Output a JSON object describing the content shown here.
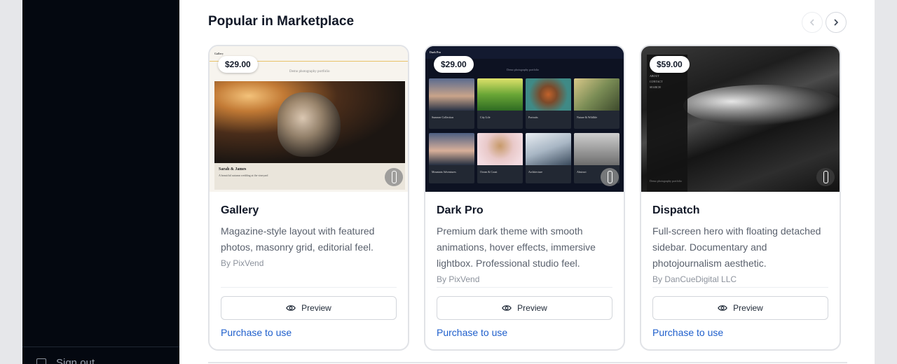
{
  "sidebar": {
    "signout_label": "Sign out"
  },
  "section": {
    "title": "Popular in Marketplace"
  },
  "cards": [
    {
      "price": "$29.00",
      "title": "Gallery",
      "description": "Magazine-style layout with featured photos, masonry grid, editorial feel.",
      "author": "By PixVend",
      "preview_label": "Preview",
      "purchase_label": "Purchase to use",
      "thumb": {
        "site_name": "Gallery",
        "tagline": "Demo photography portfolio",
        "couple": "Sarah & James",
        "couple_sub": "A beautiful autumn wedding at the vineyard"
      }
    },
    {
      "price": "$29.00",
      "title": "Dark Pro",
      "description": "Premium dark theme with smooth animations, hover effects, immersive lightbox. Professional studio feel.",
      "author": "By PixVend",
      "preview_label": "Preview",
      "purchase_label": "Purchase to use",
      "thumb": {
        "site_name": "Dark Pro",
        "tagline": "Demo photography portfolio",
        "tiles": [
          "Summer Collection",
          "City Life",
          "Portraits",
          "Nature & Wildlife",
          "Mountain Adventures",
          "Ocean & Coast",
          "Architecture",
          "Abstract"
        ]
      }
    },
    {
      "price": "$59.00",
      "title": "Dispatch",
      "description": "Full-screen hero with floating detached sidebar. Documentary and photojournalism aesthetic.",
      "author": "By DanCueDigital LLC",
      "preview_label": "Preview",
      "purchase_label": "Purchase to use",
      "thumb": {
        "menu": [
          "ABOUT",
          "CONTACT",
          "SEARCH"
        ],
        "caption": "Demo photography portfolio"
      }
    }
  ],
  "colors": {
    "accent_link": "#1f5fcc",
    "sidebar_bg": "#040810"
  }
}
